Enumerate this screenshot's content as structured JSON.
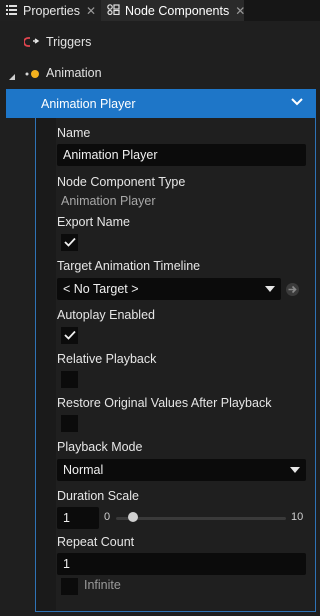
{
  "tabs": [
    {
      "label": "Properties",
      "icon": "list-icon"
    },
    {
      "label": "Node Components",
      "icon": "node-components-icon"
    }
  ],
  "tree": {
    "triggers": {
      "label": "Triggers",
      "icon": "trigger-link-icon"
    },
    "animation": {
      "label": "Animation",
      "icon": "animation-dot-icon"
    },
    "player_header": {
      "label": "Animation Player"
    }
  },
  "colors": {
    "accent": "#1e76c8",
    "panel_border": "#2f73b6",
    "trigger_icon": "#e0454f",
    "animation_icon": "#f2b01e"
  },
  "props": {
    "name_label": "Name",
    "name_value": "Animation Player",
    "type_label": "Node Component Type",
    "type_value": "Animation Player",
    "export_label": "Export Name",
    "export_checked": true,
    "target_label": "Target Animation Timeline",
    "target_value": "< No Target >",
    "autoplay_label": "Autoplay Enabled",
    "autoplay_checked": true,
    "relative_label": "Relative Playback",
    "relative_checked": false,
    "restore_label": "Restore Original Values After Playback",
    "restore_checked": false,
    "mode_label": "Playback Mode",
    "mode_value": "Normal",
    "duration_label": "Duration Scale",
    "duration_value": "1",
    "duration_min": "0",
    "duration_max": "10",
    "duration_fraction": 0.1,
    "repeat_label": "Repeat Count",
    "repeat_value": "1",
    "infinite_label": "Infinite",
    "infinite_checked": false
  }
}
